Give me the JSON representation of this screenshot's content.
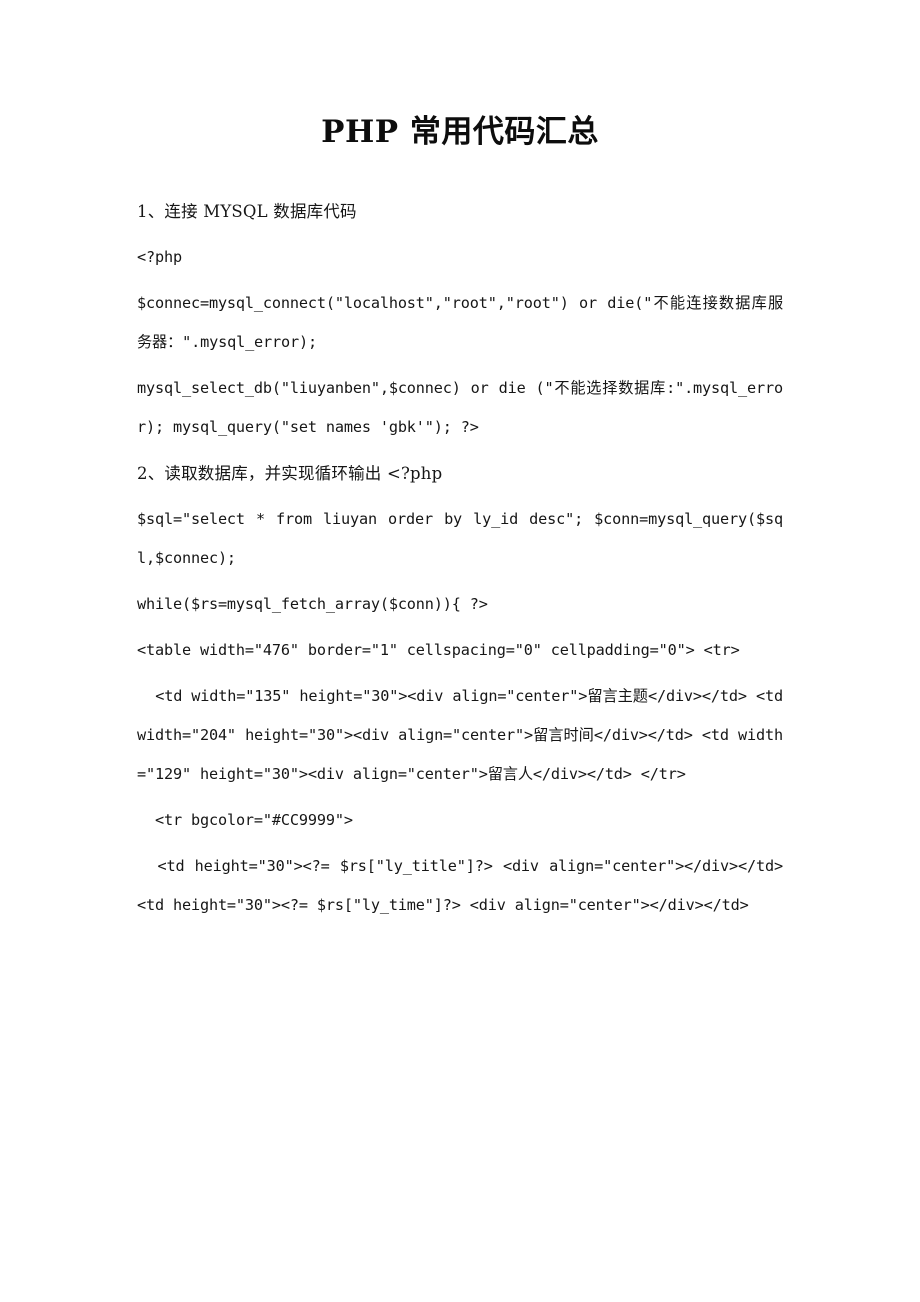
{
  "document": {
    "title": "PHP 常用代码汇总",
    "blocks": [
      {
        "id": "sec1-heading",
        "kind": "prose",
        "text": "1、连接 MYSQL 数据库代码"
      },
      {
        "id": "php-open",
        "kind": "code",
        "text": "<?php"
      },
      {
        "id": "mysql-connect",
        "kind": "code",
        "text": "$connec=mysql_connect(\"localhost\",\"root\",\"root\") or die(\"不能连接数据库服务器：\".mysql_error);"
      },
      {
        "id": "mysql-select-db",
        "kind": "code",
        "text": "mysql_select_db(\"liuyanben\",$connec) or die (\"不能选择数据库:\".mysql_error);        mysql_query(\"set names 'gbk'\"); ?>"
      },
      {
        "id": "sec2-heading",
        "kind": "prose",
        "text": "2、读取数据库，并实现循环输出 <?php"
      },
      {
        "id": "sql-query",
        "kind": "code",
        "text": "$sql=\"select * from liuyan order by ly_id desc\"; $conn=mysql_query($sql,$connec);"
      },
      {
        "id": "while-loop",
        "kind": "code",
        "text": "while($rs=mysql_fetch_array($conn)){   ?>"
      },
      {
        "id": "table-open",
        "kind": "code",
        "text": "<table width=\"476\" border=\"1\" cellspacing=\"0\" cellpadding=\"0\"> <tr>"
      },
      {
        "id": "header-cells",
        "kind": "code",
        "indent": true,
        "text": "<td width=\"135\" height=\"30\"><div align=\"center\">留言主题</div></td>   <td width=\"204\" height=\"30\"><div align=\"center\">留言时间</div></td>    <td width=\"129\" height=\"30\"><div align=\"center\">留言人</div></td>   </tr>"
      },
      {
        "id": "row-bgcolor",
        "kind": "code",
        "indent": true,
        "text": "<tr bgcolor=\"#CC9999\">"
      },
      {
        "id": "data-cells",
        "kind": "code",
        "indent": true,
        "text": "<td   height=\"30\"><?=   $rs[\"ly_title\"]?>              <div align=\"center\"></div></td>            <td    height=\"30\"><?= $rs[\"ly_time\"]?>    <div align=\"center\"></div></td>"
      }
    ]
  },
  "meta": {
    "accent_color": "#CC9999",
    "text_color": "#161616",
    "page_background": "#FFFFFF"
  }
}
